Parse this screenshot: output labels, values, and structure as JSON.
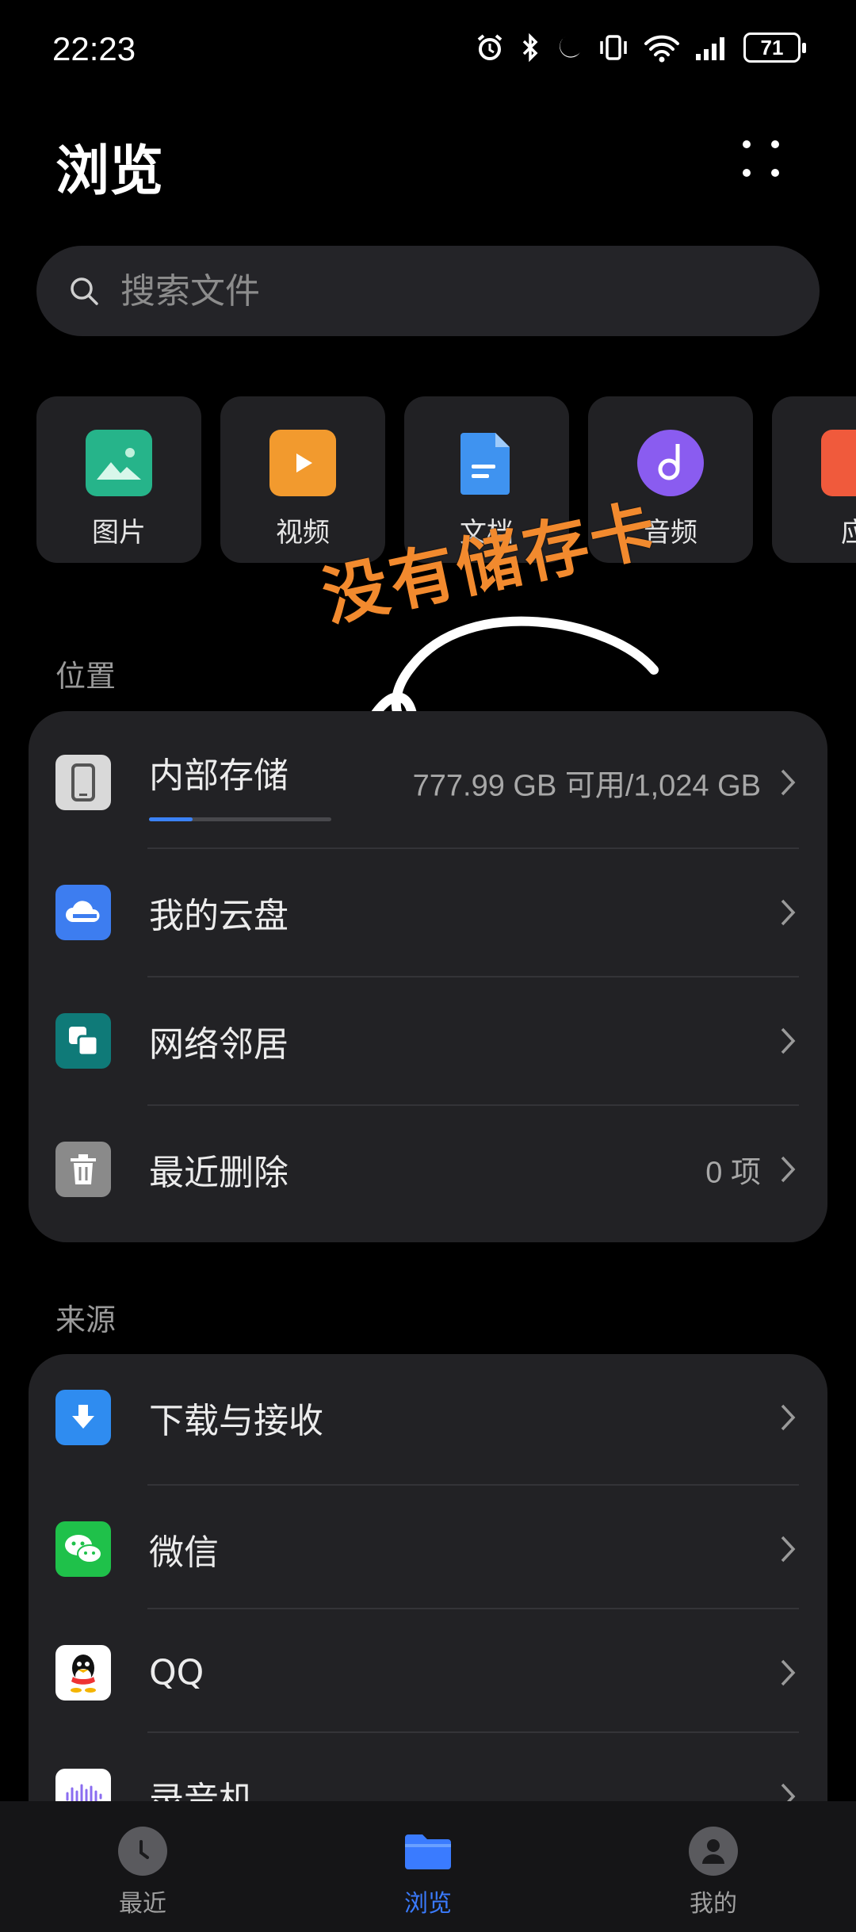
{
  "status_bar": {
    "time": "22:23",
    "battery": "71"
  },
  "header": {
    "title": "浏览"
  },
  "search": {
    "placeholder": "搜索文件"
  },
  "categories": [
    {
      "label": "图片",
      "icon": "image-icon",
      "color": "#26b48a"
    },
    {
      "label": "视频",
      "icon": "video-icon",
      "color": "#f29a2e"
    },
    {
      "label": "文档",
      "icon": "document-icon",
      "color": "#3f93f0"
    },
    {
      "label": "音频",
      "icon": "audio-icon",
      "color": "#8a5cf0"
    },
    {
      "label": "应",
      "icon": "app-icon",
      "color": "#f05a3c"
    }
  ],
  "overlay": {
    "text": "没有储存卡",
    "color": "#f28a2e"
  },
  "locations": {
    "section_label": "位置",
    "items": [
      {
        "label": "内部存储",
        "meta": "777.99 GB 可用/1,024 GB",
        "icon": "phone-icon",
        "usage_fraction": 0.24
      },
      {
        "label": "我的云盘",
        "meta": "",
        "icon": "cloud-icon"
      },
      {
        "label": "网络邻居",
        "meta": "",
        "icon": "network-icon"
      },
      {
        "label": "最近删除",
        "meta": "0 项",
        "icon": "trash-icon"
      }
    ]
  },
  "sources": {
    "section_label": "来源",
    "items": [
      {
        "label": "下载与接收",
        "icon": "download-icon"
      },
      {
        "label": "微信",
        "icon": "wechat-icon"
      },
      {
        "label": "QQ",
        "icon": "qq-icon"
      },
      {
        "label": "录音机",
        "icon": "recorder-icon"
      }
    ]
  },
  "bottom_nav": [
    {
      "label": "最近",
      "icon": "clock-icon",
      "active": false
    },
    {
      "label": "浏览",
      "icon": "folder-icon",
      "active": true
    },
    {
      "label": "我的",
      "icon": "profile-icon",
      "active": false
    }
  ],
  "colors": {
    "accent": "#3a7bff",
    "background": "#000000",
    "card": "#222225"
  }
}
